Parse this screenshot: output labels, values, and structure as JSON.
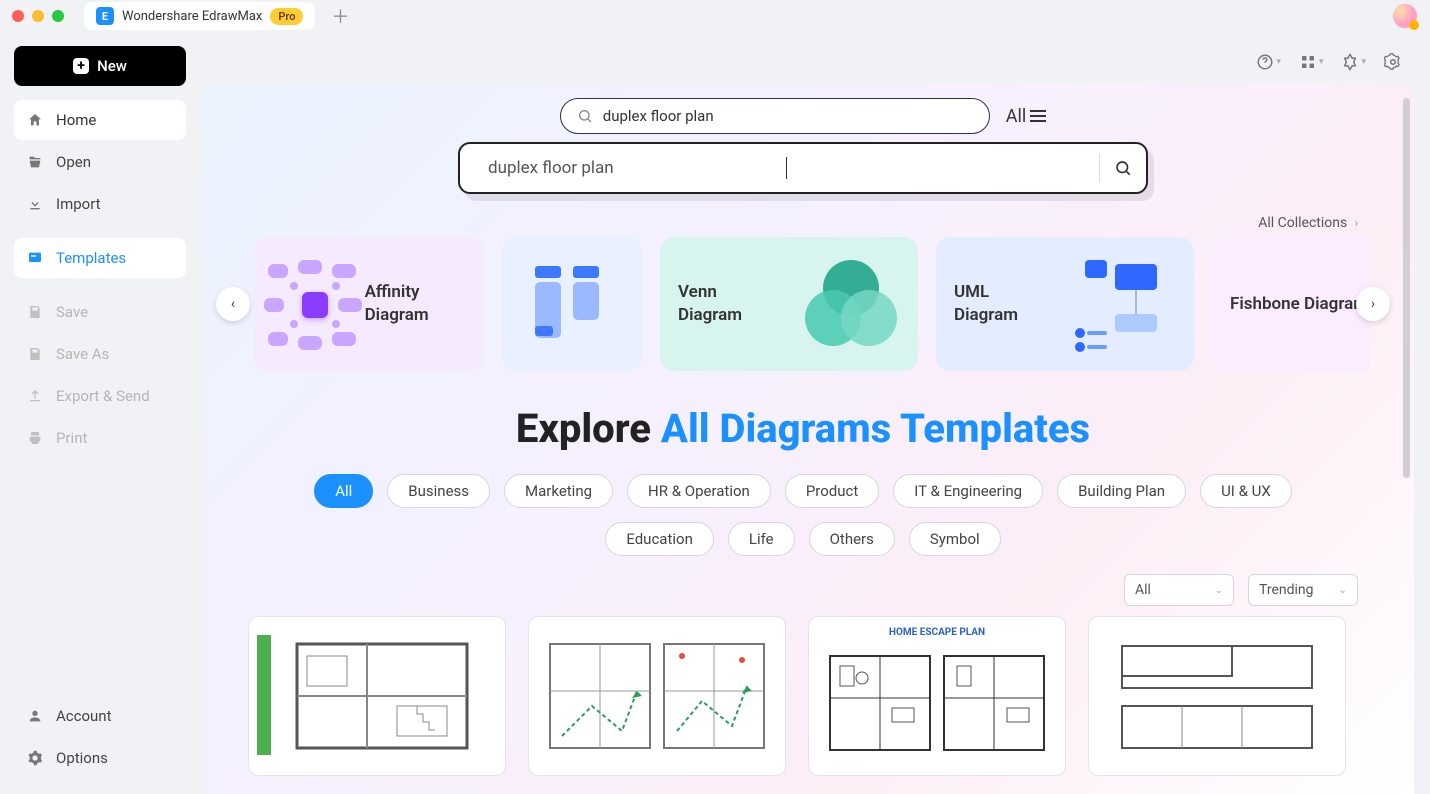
{
  "titlebar": {
    "app_title": "Wondershare EdrawMax",
    "pro_badge": "Pro"
  },
  "sidebar": {
    "new_label": "New",
    "items": [
      {
        "label": "Home"
      },
      {
        "label": "Open"
      },
      {
        "label": "Import"
      },
      {
        "label": "Templates"
      },
      {
        "label": "Save"
      },
      {
        "label": "Save As"
      },
      {
        "label": "Export & Send"
      },
      {
        "label": "Print"
      },
      {
        "label": "Account"
      },
      {
        "label": "Options"
      }
    ]
  },
  "search": {
    "pill_value": "duplex floor plan",
    "all_label": "All",
    "large_value": "duplex floor plan"
  },
  "collections": {
    "all_link": "All Collections",
    "cards": [
      {
        "label": "Affinity Diagram"
      },
      {
        "label": "Venn Diagram"
      },
      {
        "label": "UML Diagram"
      },
      {
        "label": "Fishbone Diagram"
      }
    ]
  },
  "heading": {
    "part1": "Explore ",
    "part2": "All Diagrams Templates"
  },
  "filters": {
    "row1": [
      "All",
      "Business",
      "Marketing",
      "HR & Operation",
      "Product",
      "IT & Engineering",
      "Building Plan",
      "UI & UX"
    ],
    "row2": [
      "Education",
      "Life",
      "Others",
      "Symbol"
    ]
  },
  "sort": {
    "select1": "All",
    "select2": "Trending"
  },
  "templates": {
    "card3_label": "HOME ESCAPE PLAN"
  }
}
